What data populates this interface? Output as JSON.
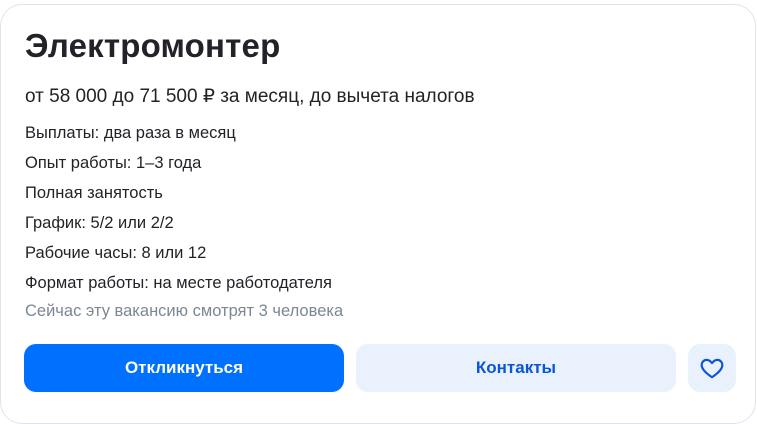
{
  "vacancy": {
    "title": "Электромонтер",
    "salary": "от 58 000 до 71 500 ₽ за месяц, до вычета налогов",
    "details": [
      "Выплаты: два раза в месяц",
      "Опыт работы: 1–3 года",
      "Полная занятость",
      "График: 5/2 или 2/2",
      "Рабочие часы: 8 или 12",
      "Формат работы: на месте работодателя"
    ],
    "viewers_text": "Сейчас эту вакансию смотрят 3 человека"
  },
  "actions": {
    "respond_label": "Откликнуться",
    "contacts_label": "Контакты",
    "favorite_icon": "heart-icon"
  },
  "colors": {
    "primary": "#0070ff",
    "secondary_bg": "#e9f2fc",
    "secondary_text": "#0b55d9",
    "muted_text": "#7b8794"
  }
}
